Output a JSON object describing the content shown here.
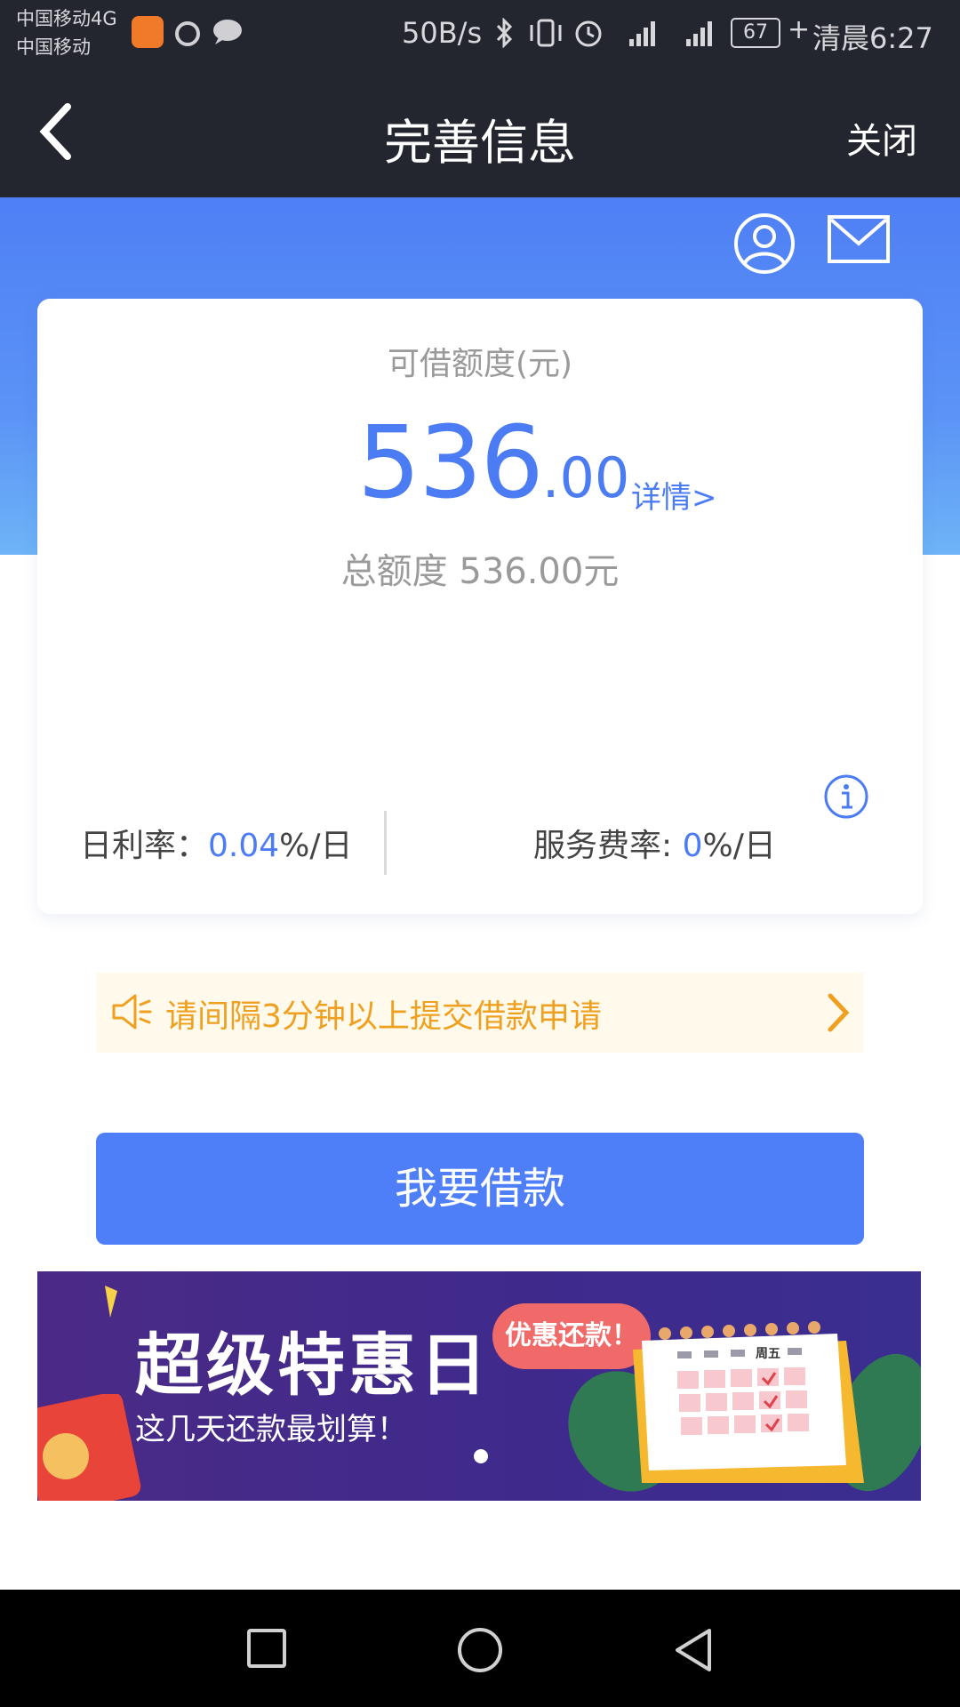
{
  "status_bar": {
    "carrier1": "中国移动4G",
    "carrier2": "中国移动",
    "net_speed": "50B/s",
    "battery": "67",
    "time": "清晨6:27"
  },
  "nav": {
    "title": "完善信息",
    "close_label": "关闭"
  },
  "card": {
    "label": "可借额度(元)",
    "amount_int": "536",
    "amount_dec": ".00",
    "detail_link": "详情>",
    "total": "总额度 536.00元",
    "daily_rate_label": "日利率：",
    "daily_rate_value": "0.04",
    "daily_rate_unit": "%/日",
    "service_rate_label": "服务费率: ",
    "service_rate_value": "0",
    "service_rate_unit": "%/日"
  },
  "notice": {
    "text": "请间隔3分钟以上提交借款申请"
  },
  "borrow_button": "我要借款",
  "banner": {
    "title": "超级特惠日",
    "subtitle": "这几天还款最划算！",
    "badge": "优惠还款！",
    "calendar_day": "周五"
  },
  "colors": {
    "accent": "#4c7cf3",
    "header_dark": "#23252f",
    "notice_text": "#f0a020"
  }
}
